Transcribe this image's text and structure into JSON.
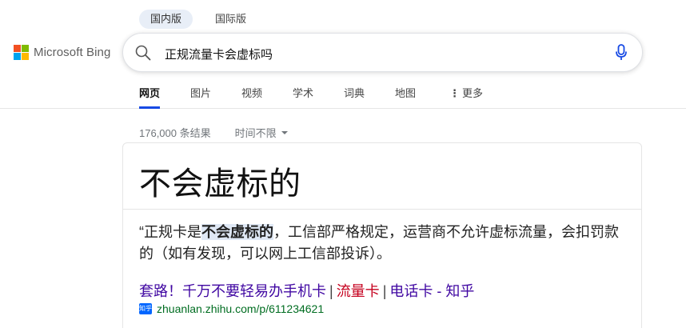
{
  "region_tabs": [
    {
      "label": "国内版",
      "active": true
    },
    {
      "label": "国际版",
      "active": false
    }
  ],
  "logo": {
    "text": "Microsoft Bing",
    "colors": [
      "#f25022",
      "#7fba00",
      "#00a4ef",
      "#ffb900"
    ]
  },
  "search": {
    "query": "正规流量卡会虚标吗",
    "icon": "search-icon",
    "mic_icon": "microphone-icon",
    "mic_color": "#174ae4"
  },
  "nav": {
    "items": [
      {
        "label": "网页",
        "active": true
      },
      {
        "label": "图片",
        "active": false
      },
      {
        "label": "视频",
        "active": false
      },
      {
        "label": "学术",
        "active": false
      },
      {
        "label": "词典",
        "active": false
      },
      {
        "label": "地图",
        "active": false
      }
    ],
    "more_label": "更多",
    "more_icon": "more-vertical-icon",
    "accent": "#174ae4"
  },
  "results_meta": {
    "count": "176,000 条结果",
    "time_filter": "时间不限"
  },
  "answer_card": {
    "answer": "不会虚标的",
    "snippet_prefix": "“正规卡是",
    "snippet_highlight": "不会虚标的",
    "snippet_suffix": "，工信部严格规定，运营商不允许虚标流量，会扣罚款的（如有发现，可以网上工信部投诉）。",
    "source_title_part1": "套路！千万不要轻易办手机卡",
    "source_title_sep1": "|",
    "source_title_part2": "流量卡",
    "source_title_sep2": "|",
    "source_title_part3": "电话卡 - 知乎",
    "source_favicon": "知乎",
    "source_url": "zhuanlan.zhihu.com/p/611234621"
  }
}
